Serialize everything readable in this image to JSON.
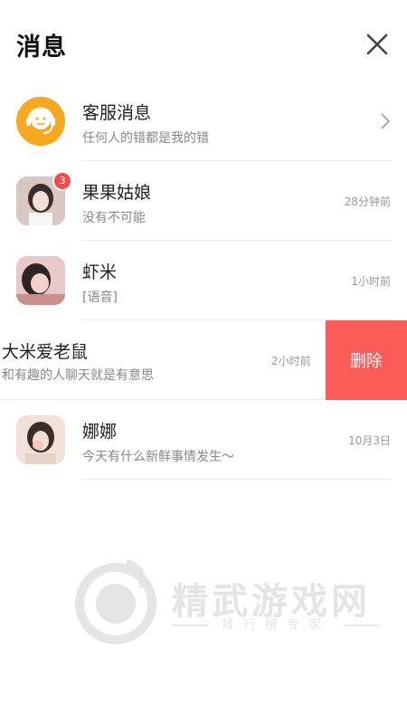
{
  "header": {
    "title": "消息"
  },
  "conversations": [
    {
      "name": "客服消息",
      "preview": "任何人的错都是我的错",
      "time": "",
      "badge": "",
      "avatar": "headset-icon"
    },
    {
      "name": "果果姑娘",
      "preview": "没有不可能",
      "time": "28分钟前",
      "badge": "3",
      "avatar": "user-photo"
    },
    {
      "name": "虾米",
      "preview": "[语音]",
      "time": "1小时前",
      "badge": "",
      "avatar": "user-photo"
    },
    {
      "name": "大米爱老鼠",
      "preview": "和有趣的人聊天就是有意思",
      "time": "2小时前",
      "badge": "",
      "avatar": "user-photo"
    },
    {
      "name": "娜娜",
      "preview": "今天有什么新鲜事情发生～",
      "time": "10月3日",
      "badge": "",
      "avatar": "user-photo"
    }
  ],
  "swipe_action": {
    "label": "删除",
    "color": "#fb5c57"
  },
  "watermark": {
    "title": "精武游戏网",
    "subtitle": "排行榜专家"
  },
  "colors": {
    "accent": "#f5a623",
    "badge": "#f24b4b",
    "delete": "#fb5c57"
  }
}
